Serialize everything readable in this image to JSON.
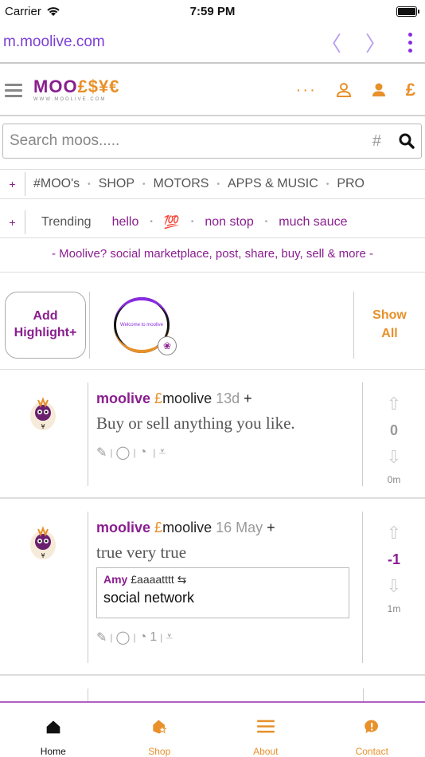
{
  "status_bar": {
    "carrier": "Carrier",
    "time": "7:59 PM",
    "battery_level": 1.0
  },
  "browser": {
    "url": "m.moolive.com",
    "back": "〈",
    "forward": "〉"
  },
  "header": {
    "logo_prefix": "MOO",
    "logo_symbols": "£$¥€",
    "logo_subtitle": "WWW.MOOLIVE.COM",
    "more_label": "···"
  },
  "search": {
    "placeholder": "Search moos.....",
    "hash": "#"
  },
  "categories": {
    "plus": "+",
    "items": [
      "#MOO's",
      "SHOP",
      "MOTORS",
      "APPS & MUSIC",
      "PRO"
    ]
  },
  "trending": {
    "plus": "+",
    "label": "Trending",
    "items": [
      "hello",
      "💯",
      "non stop",
      "much sauce"
    ]
  },
  "tagline": "- Moolive? social marketplace, post, share, buy, sell & more -",
  "highlights": {
    "add_line1": "Add",
    "add_line2": "Highlight+",
    "thumb_text": "Welcome to moolive",
    "show_line1": "Show",
    "show_line2": "All"
  },
  "posts": [
    {
      "author": "moolive",
      "pound": "£",
      "handle": "moolive",
      "ago": "13d",
      "plus": "+",
      "text": "Buy or sell anything you like.",
      "count": "",
      "score": "0",
      "time": "0m"
    },
    {
      "author": "moolive",
      "pound": "£",
      "handle": "moolive",
      "ago": "16 May",
      "plus": "+",
      "text": "true very true",
      "quote_author": "Amy",
      "quote_handle": "£aaaatttt",
      "quote_text": "social network",
      "count": "1",
      "score": "-1",
      "time": "1m"
    }
  ],
  "tabs": [
    {
      "label": "Home",
      "icon": "home-icon"
    },
    {
      "label": "Shop",
      "icon": "shop-star-icon"
    },
    {
      "label": "About",
      "icon": "menu-icon"
    },
    {
      "label": "Contact",
      "icon": "chat-icon"
    }
  ],
  "colors": {
    "brand_purple": "#8a1e8f",
    "brand_orange": "#e8902a",
    "link_purple": "#7b3fd6"
  }
}
